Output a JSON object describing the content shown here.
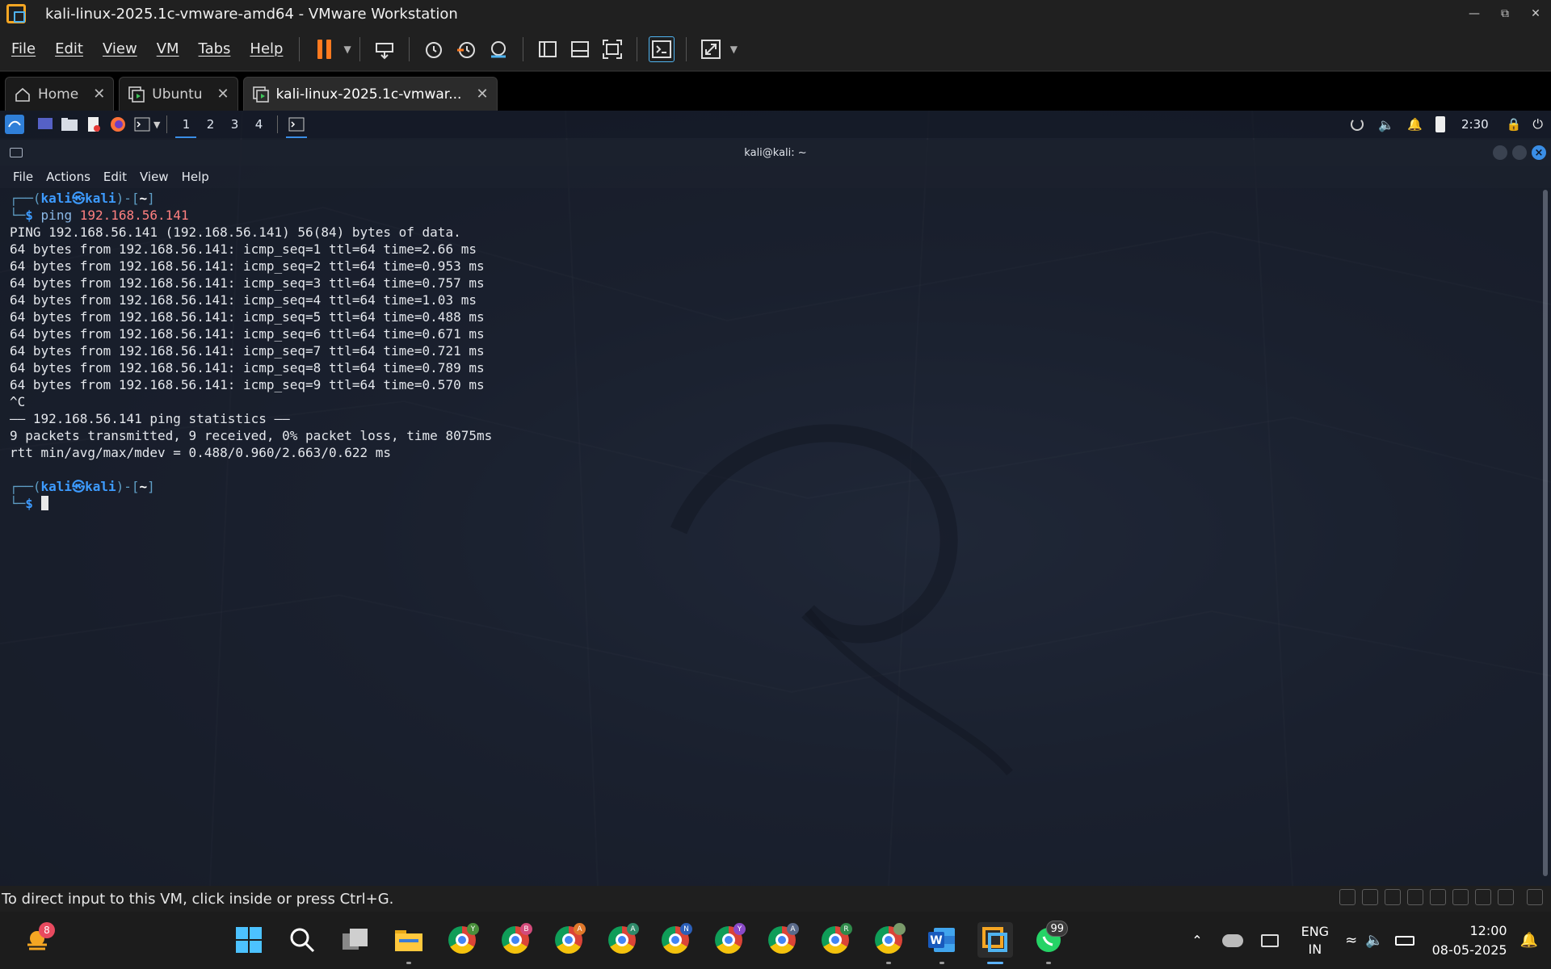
{
  "window": {
    "title": "kali-linux-2025.1c-vmware-amd64 - VMware Workstation"
  },
  "menu": [
    "File",
    "Edit",
    "View",
    "VM",
    "Tabs",
    "Help"
  ],
  "tabs": [
    {
      "label": "Home",
      "icon": "home-icon"
    },
    {
      "label": "Ubuntu",
      "icon": "vm-icon"
    },
    {
      "label": "kali-linux-2025.1c-vmwar...",
      "icon": "vm-icon"
    }
  ],
  "kali_panel": {
    "workspaces": [
      "1",
      "2",
      "3",
      "4"
    ],
    "active_workspace": "1",
    "clock": "2:30"
  },
  "terminal": {
    "title": "kali@kali: ~",
    "menu": [
      "File",
      "Actions",
      "Edit",
      "View",
      "Help"
    ],
    "prompt_user": "kali",
    "prompt_at": "㉿",
    "prompt_host": "kali",
    "prompt_dir": "~",
    "command": "ping",
    "command_arg": "192.168.56.141",
    "output": [
      "PING 192.168.56.141 (192.168.56.141) 56(84) bytes of data.",
      "64 bytes from 192.168.56.141: icmp_seq=1 ttl=64 time=2.66 ms",
      "64 bytes from 192.168.56.141: icmp_seq=2 ttl=64 time=0.953 ms",
      "64 bytes from 192.168.56.141: icmp_seq=3 ttl=64 time=0.757 ms",
      "64 bytes from 192.168.56.141: icmp_seq=4 ttl=64 time=1.03 ms",
      "64 bytes from 192.168.56.141: icmp_seq=5 ttl=64 time=0.488 ms",
      "64 bytes from 192.168.56.141: icmp_seq=6 ttl=64 time=0.671 ms",
      "64 bytes from 192.168.56.141: icmp_seq=7 ttl=64 time=0.721 ms",
      "64 bytes from 192.168.56.141: icmp_seq=8 ttl=64 time=0.789 ms",
      "64 bytes from 192.168.56.141: icmp_seq=9 ttl=64 time=0.570 ms",
      "^C",
      "—— 192.168.56.141 ping statistics ——",
      "9 packets transmitted, 9 received, 0% packet loss, time 8075ms",
      "rtt min/avg/max/mdev = 0.488/0.960/2.663/0.622 ms"
    ]
  },
  "status_bar": {
    "text": "To direct input to this VM, click inside or press Ctrl+G."
  },
  "taskbar": {
    "weather_badge": "8",
    "chrome_profiles": [
      "Y",
      "B",
      "A",
      "A",
      "N",
      "Y",
      "A",
      "R",
      ""
    ],
    "whatsapp_badge": "99",
    "lang_line1": "ENG",
    "lang_line2": "IN",
    "time": "12:00",
    "date": "08-05-2025"
  },
  "colors": {
    "accent_orange": "#ff7a1f",
    "kali_blue": "#3d9bff",
    "ip_red": "#ff8080"
  }
}
